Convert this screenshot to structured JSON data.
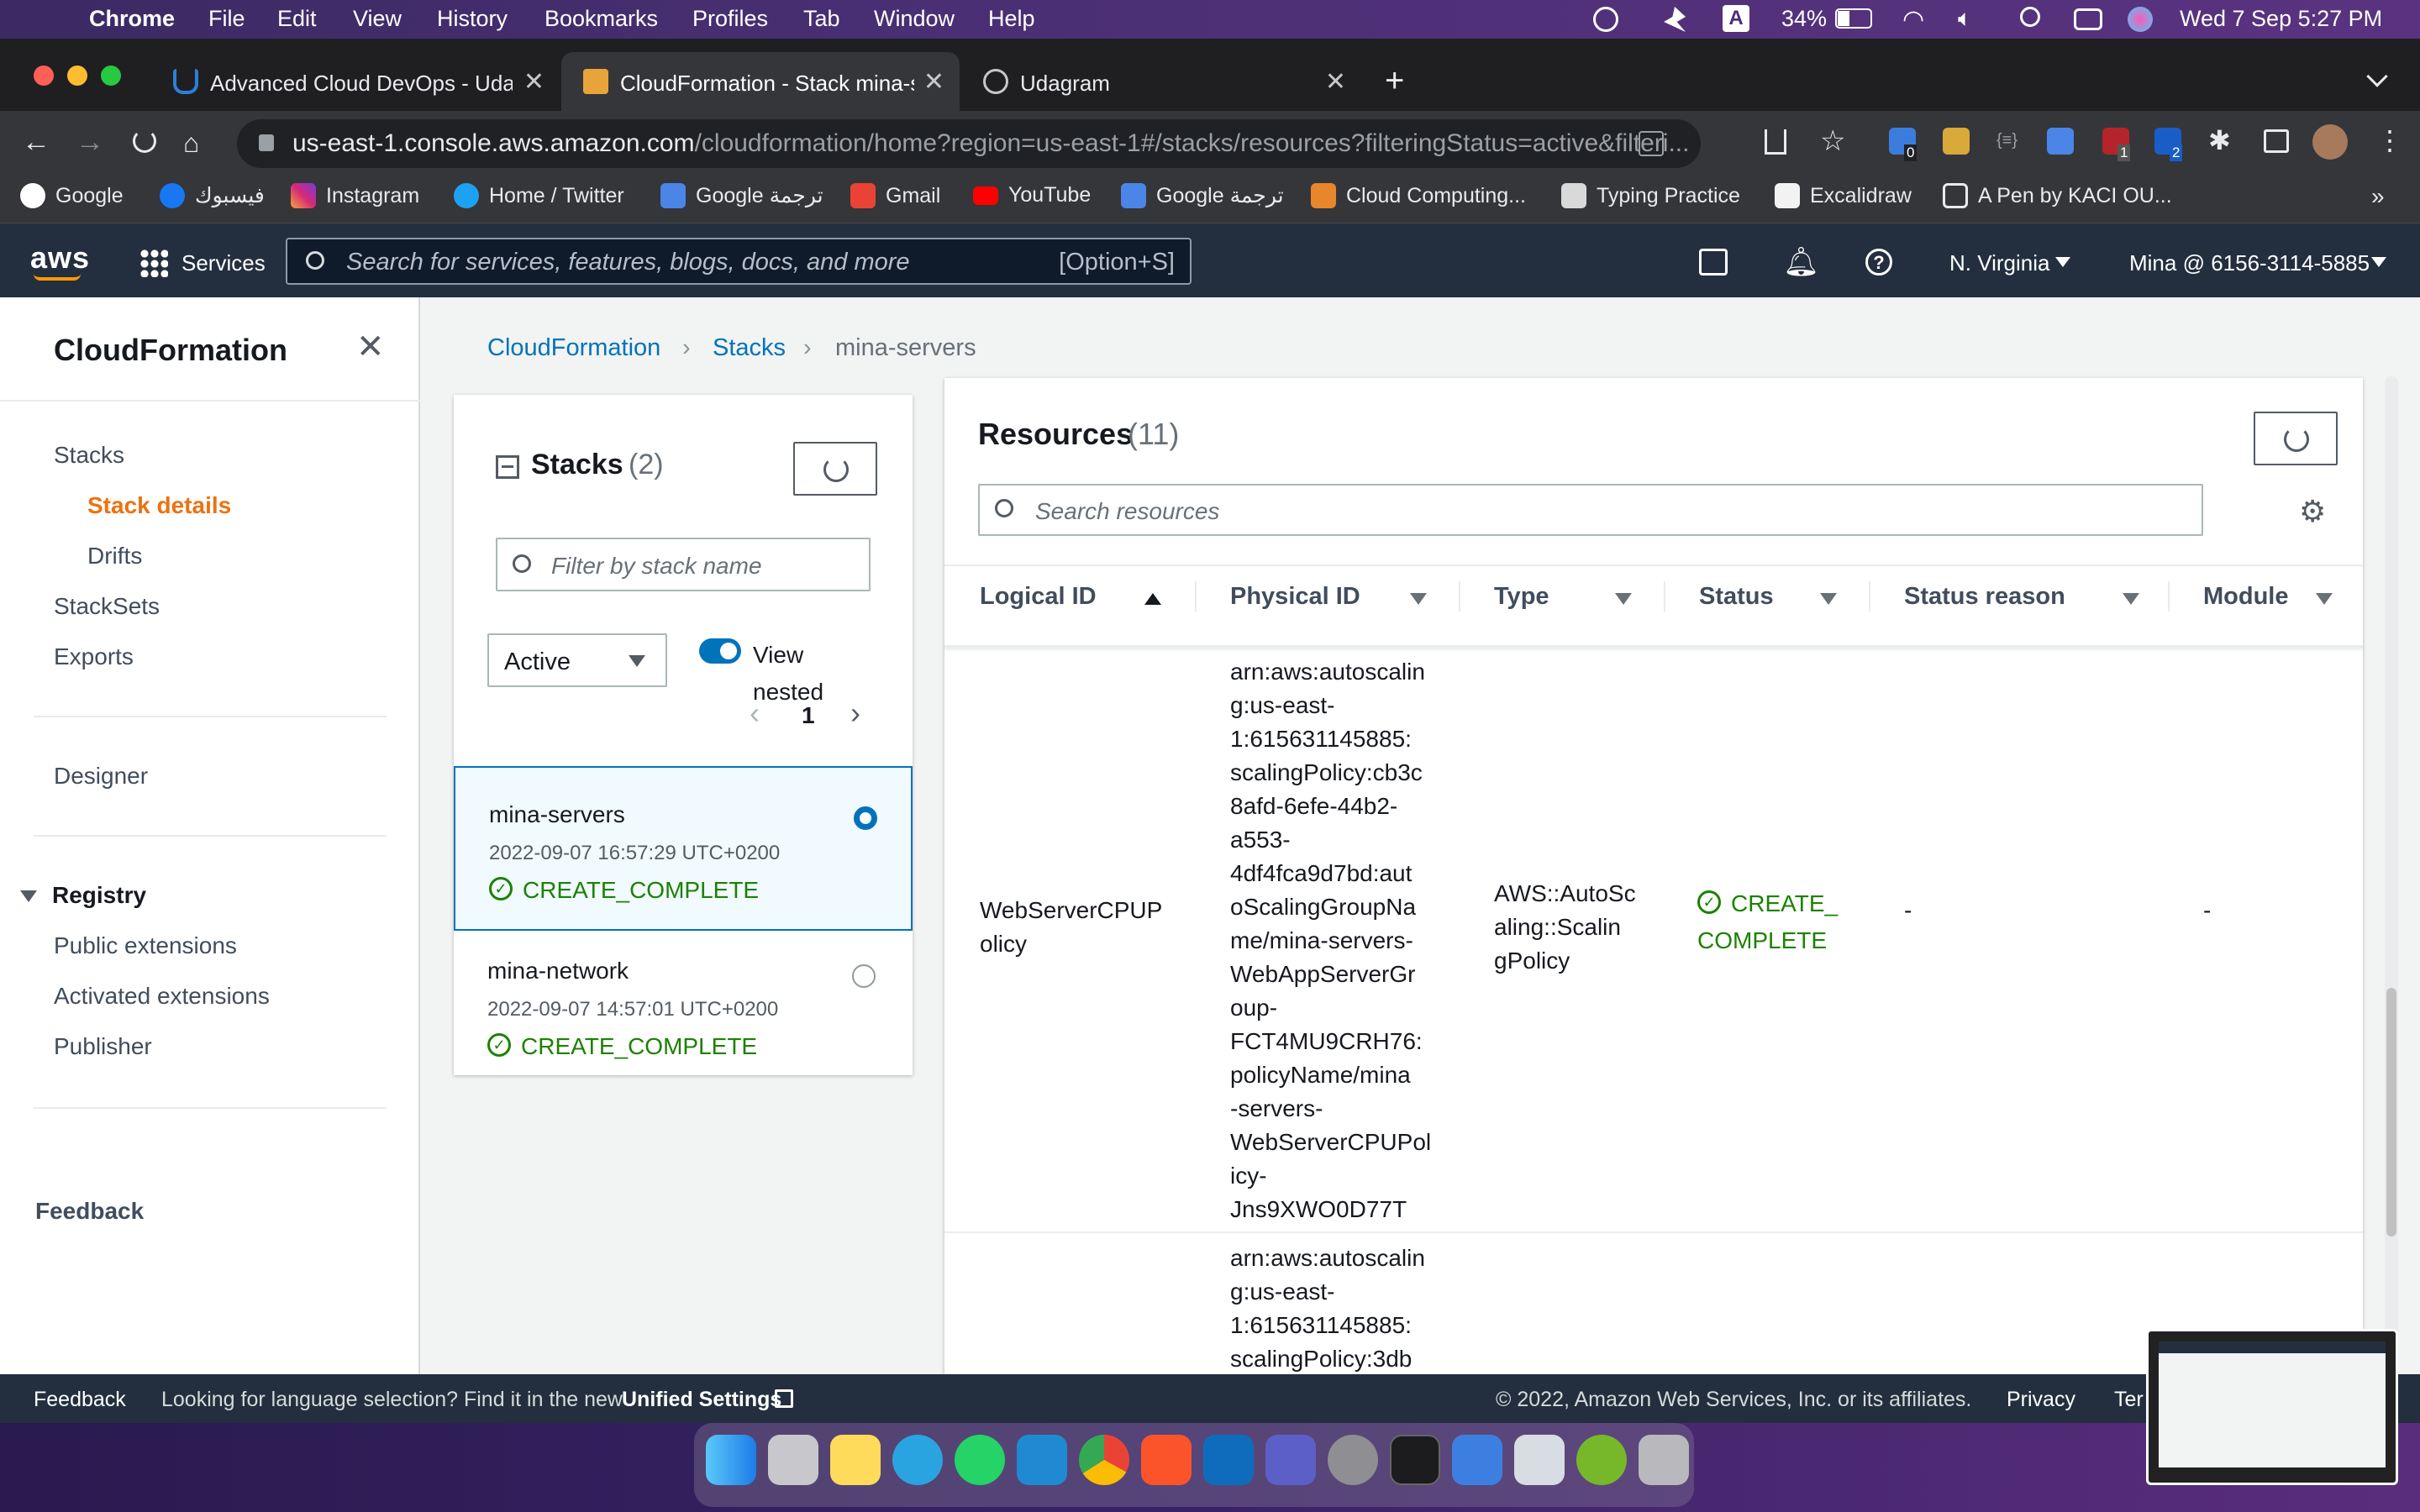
{
  "menubar": {
    "app": "Chrome",
    "items": [
      "File",
      "Edit",
      "View",
      "History",
      "Bookmarks",
      "Profiles",
      "Tab",
      "Window",
      "Help"
    ],
    "battery": "34%",
    "datetime": "Wed 7 Sep  5:27 PM",
    "a_badge": "A"
  },
  "tabs": [
    {
      "title": "Advanced Cloud DevOps - Uda"
    },
    {
      "title": "CloudFormation - Stack mina-s"
    },
    {
      "title": "Udagram"
    }
  ],
  "omnibox": {
    "host": "us-east-1.console.aws.amazon.com",
    "path": "/cloudformation/home?region=us-east-1#/stacks/resources?filteringStatus=active&filteri..."
  },
  "bookmarks": [
    "Google",
    "فيسبوك",
    "Instagram",
    "Home / Twitter",
    "Google ترجمة",
    "Gmail",
    "YouTube",
    "Google ترجمة",
    "Cloud Computing...",
    "Typing Practice",
    "Excalidraw",
    "A Pen by KACI OU..."
  ],
  "ext_badges": {
    "b1": "0",
    "b2": "1",
    "b3": "2",
    "dots": "{≡}"
  },
  "awsnav": {
    "logo": "aws",
    "services": "Services",
    "search_placeholder": "Search for services, features, blogs, docs, and more",
    "shortcut": "[Option+S]",
    "region": "N. Virginia",
    "account": "Mina @ 6156-3114-5885"
  },
  "sidebar": {
    "title": "CloudFormation",
    "stacks": "Stacks",
    "stack_details": "Stack details",
    "drifts": "Drifts",
    "stacksets": "StackSets",
    "exports": "Exports",
    "designer": "Designer",
    "registry": "Registry",
    "public_ext": "Public extensions",
    "activated_ext": "Activated extensions",
    "publisher": "Publisher",
    "feedback": "Feedback"
  },
  "breadcrumb": {
    "c1": "CloudFormation",
    "c2": "Stacks",
    "c3": "mina-servers"
  },
  "stacks_panel": {
    "title": "Stacks",
    "count": "(2)",
    "filter_placeholder": "Filter by stack name",
    "status_select": "Active",
    "view_nested": "View nested",
    "page": "1",
    "items": [
      {
        "name": "mina-servers",
        "date": "2022-09-07 16:57:29 UTC+0200",
        "status": "CREATE_COMPLETE",
        "selected": true
      },
      {
        "name": "mina-network",
        "date": "2022-09-07 14:57:01 UTC+0200",
        "status": "CREATE_COMPLETE",
        "selected": false
      }
    ]
  },
  "resources": {
    "title": "Resources",
    "count": "(11)",
    "search_placeholder": "Search resources",
    "columns": [
      "Logical ID",
      "Physical ID",
      "Type",
      "Status",
      "Status reason",
      "Module"
    ],
    "rows": [
      {
        "logical_id": [
          "WebServerCPUP",
          "olicy"
        ],
        "physical_id": [
          "arn:aws:autoscalin",
          "g:us-east-",
          "1:615631145885:",
          "scalingPolicy:cb3c",
          "8afd-6efe-44b2-",
          "a553-",
          "4df4fca9d7bd:aut",
          "oScalingGroupNa",
          "me/mina-servers-",
          "WebAppServerGr",
          "oup-",
          "FCT4MU9CRH76:",
          "policyName/mina",
          "-servers-",
          "WebServerCPUPol",
          "icy-",
          "Jns9XWO0D77T"
        ],
        "type": [
          "AWS::AutoSc",
          "aling::Scalin",
          "gPolicy"
        ],
        "status": [
          "CREATE_",
          "COMPLETE"
        ],
        "reason": "-",
        "module": "-"
      },
      {
        "physical_id": [
          "arn:aws:autoscalin",
          "g:us-east-",
          "1:615631145885:",
          "scalingPolicy:3db"
        ]
      }
    ]
  },
  "footer": {
    "feedback": "Feedback",
    "lang": "Looking for language selection? Find it in the new",
    "unified": "Unified Settings",
    "copyright": "© 2022, Amazon Web Services, Inc. or its affiliates.",
    "privacy": "Privacy",
    "terms": "Ter"
  },
  "colors": {
    "aws_orange": "#ec7211",
    "aws_blue": "#0073bb",
    "success": "#1d8102",
    "nav": "#232f3e"
  }
}
